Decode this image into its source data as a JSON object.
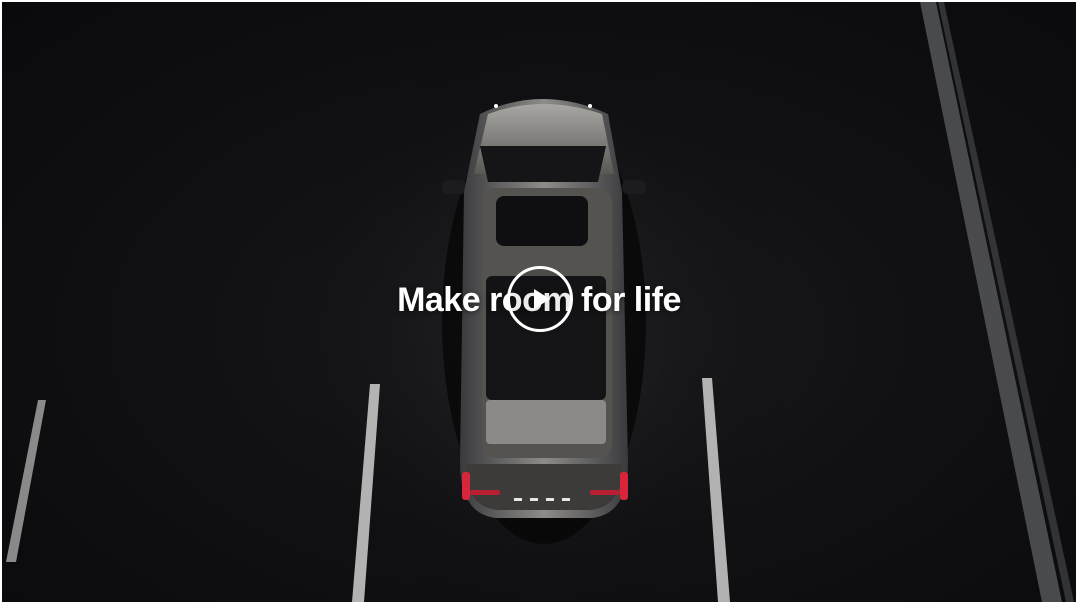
{
  "video": {
    "headline": "Make room for life"
  },
  "controls": {
    "play_icon": "play-icon"
  }
}
